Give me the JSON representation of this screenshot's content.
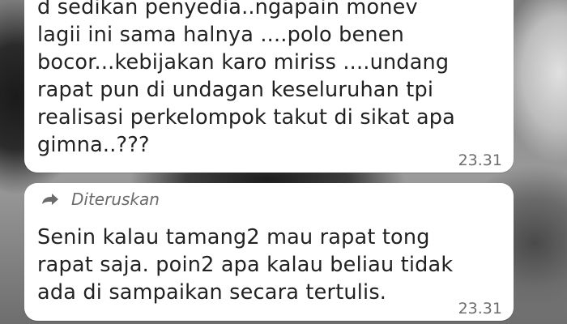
{
  "messages": [
    {
      "text": "d sedikan penyedia..ngapain monev\nlagii ini sama halnya ....polo benen\nbocor...kebijakan karo miriss ....undang\nrapat pun di undagan keseluruhan tpi\nrealisasi perkelompok takut di sikat apa\ngimna..???",
      "time": "23.31"
    },
    {
      "forwarded_label": "Diteruskan",
      "forwarded_icon": "forward-arrow-icon",
      "text": "Senin kalau tamang2 mau rapat tong\nrapat saja. poin2 apa kalau beliau tidak\nada di sampaikan secara tertulis.",
      "time": "23.31"
    }
  ],
  "colors": {
    "bubble_bg": "#ffffff",
    "text": "#222222",
    "timestamp": "#6d6d6d",
    "forwarded_label": "#6b6b6b"
  }
}
